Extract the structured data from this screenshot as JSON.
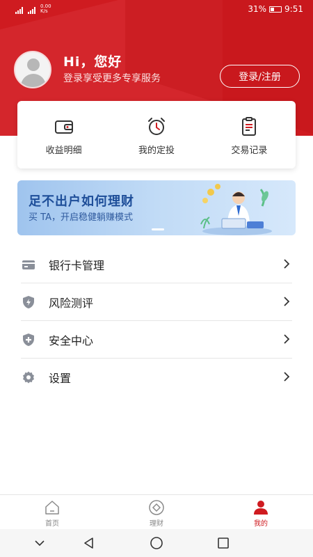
{
  "status_bar": {
    "network_speed": "0.00\nK/s",
    "battery": "31%",
    "time": "9:51"
  },
  "profile": {
    "greeting": "Hi，您好",
    "subtitle": "登录享受更多专享服务",
    "login_button": "登录/注册"
  },
  "quick_actions": [
    {
      "label": "收益明细",
      "icon": "wallet-icon"
    },
    {
      "label": "我的定投",
      "icon": "alarm-clock-icon"
    },
    {
      "label": "交易记录",
      "icon": "document-list-icon"
    }
  ],
  "banner": {
    "title": "足不出户如何理财",
    "subtitle": "买 TA，开启稳健躺赚模式",
    "image": "businessman-illustration"
  },
  "menu": [
    {
      "label": "银行卡管理",
      "icon": "bank-card-icon"
    },
    {
      "label": "风险测评",
      "icon": "shield-bolt-icon"
    },
    {
      "label": "安全中心",
      "icon": "shield-plus-icon"
    },
    {
      "label": "设置",
      "icon": "gear-icon"
    }
  ],
  "tabs": [
    {
      "label": "首页",
      "icon": "home-icon",
      "active": false
    },
    {
      "label": "理财",
      "icon": "diamond-coin-icon",
      "active": false
    },
    {
      "label": "我的",
      "icon": "user-icon",
      "active": true
    }
  ],
  "colors": {
    "brand_red": "#cf1b20",
    "banner_title": "#1e4e99",
    "menu_icon": "#8a8f99"
  }
}
